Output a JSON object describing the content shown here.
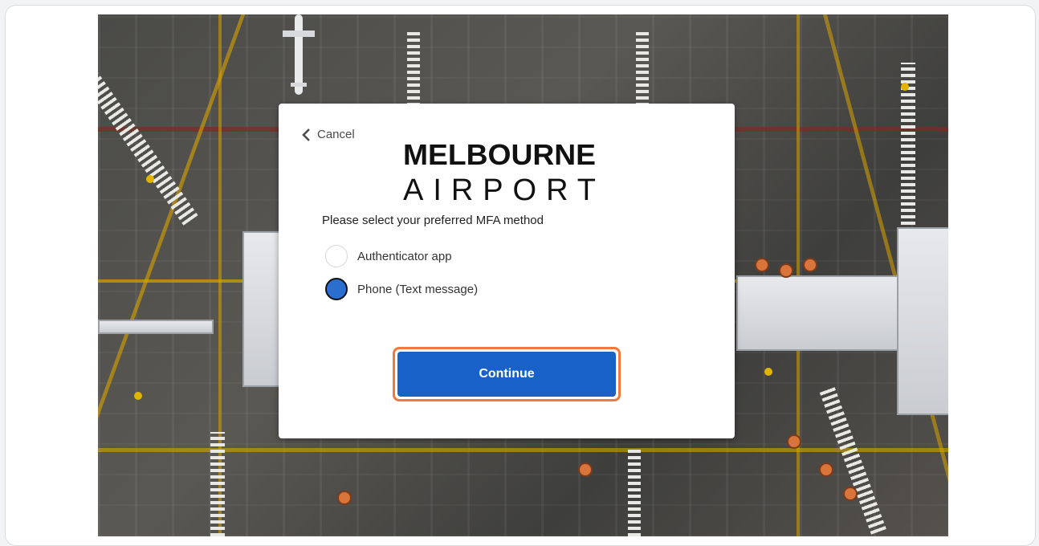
{
  "dialog": {
    "cancel_label": "Cancel",
    "logo_line1": "MELBOURNE",
    "logo_line2": "AIRPORT",
    "prompt": "Please select your preferred MFA method",
    "options": [
      {
        "label": "Authenticator app",
        "selected": false
      },
      {
        "label": "Phone (Text message)",
        "selected": true
      }
    ],
    "continue_label": "Continue"
  },
  "colors": {
    "primary_button": "#1761c9",
    "highlight_outline": "#f07a3c",
    "selected_radio": "#2a6fd0"
  },
  "icons": {
    "cancel": "chevron-left-icon"
  }
}
